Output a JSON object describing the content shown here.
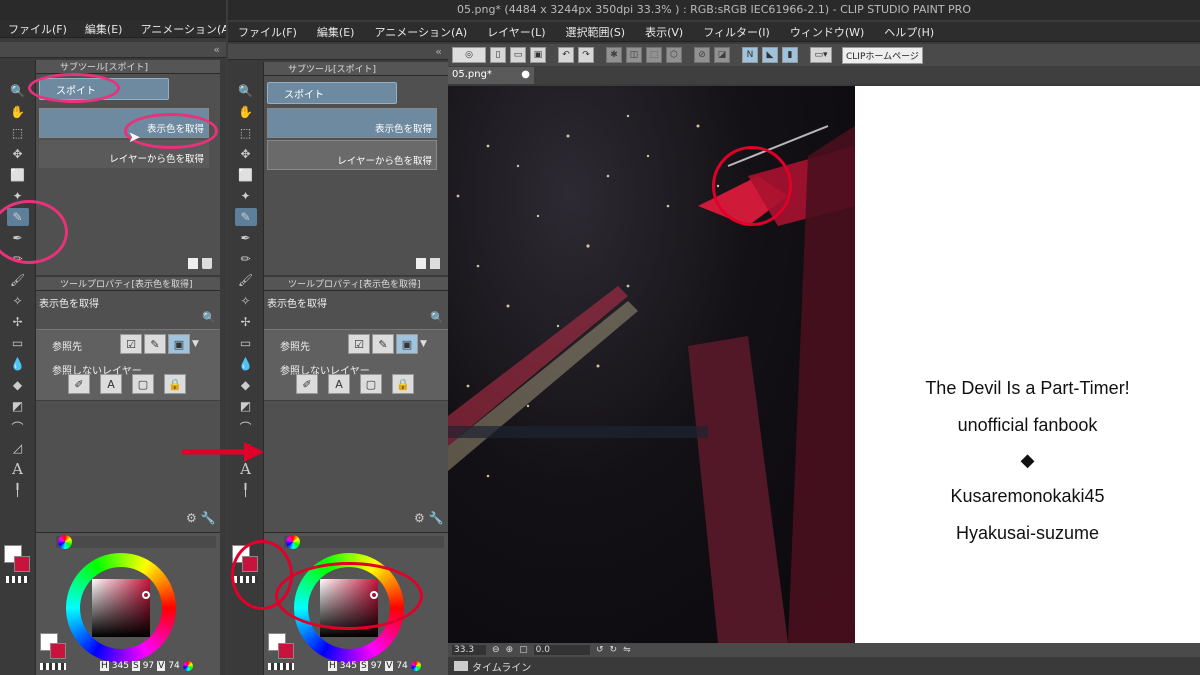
{
  "title_bar": {
    "text": "05.png* (4484 x 3244px 350dpi 33.3% ) : RGB:sRGB IEC61966-2.1) - CLIP STUDIO PAINT PRO"
  },
  "menu_left": [
    "ファイル(F)",
    "編集(E)",
    "アニメーション(A)"
  ],
  "menu_right": [
    "ファイル(F)",
    "編集(E)",
    "アニメーション(A)",
    "レイヤー(L)",
    "選択範囲(S)",
    "表示(V)",
    "フィルター(I)",
    "ウィンドウ(W)",
    "ヘルプ(H)"
  ],
  "toolbar": {
    "home_button": "CLIPホームページ"
  },
  "document_tab": "05.png*",
  "subtool_panel": {
    "header": "サブツール[スポイト]",
    "group_button": "スポイト",
    "items": [
      "表示色を取得",
      "レイヤーから色を取得"
    ]
  },
  "tool_property": {
    "header": "ツールプロパティ[表示色を取得]",
    "name": "表示色を取得",
    "reference_label": "参照先",
    "exclude_label": "参照しないレイヤー"
  },
  "color": {
    "main": "#ffffff",
    "sub": "#c8143c",
    "hsv_h_label": "H",
    "hsv_h": "345",
    "hsv_s_label": "S",
    "hsv_s": "97",
    "hsv_v_label": "V",
    "hsv_v": "74"
  },
  "status": {
    "zoom": "33.3",
    "angle": "0.0"
  },
  "timeline_tab": "タイムライン",
  "cover_text": {
    "line1": "The Devil Is a Part-Timer!",
    "line2": "unofficial fanbook",
    "diamond": "◆",
    "line3": "Kusaremonokaki45",
    "line4": "Hyakusai-suzume"
  },
  "annotation_colors": {
    "red": "#e0002a",
    "magenta": "#e8327a"
  }
}
